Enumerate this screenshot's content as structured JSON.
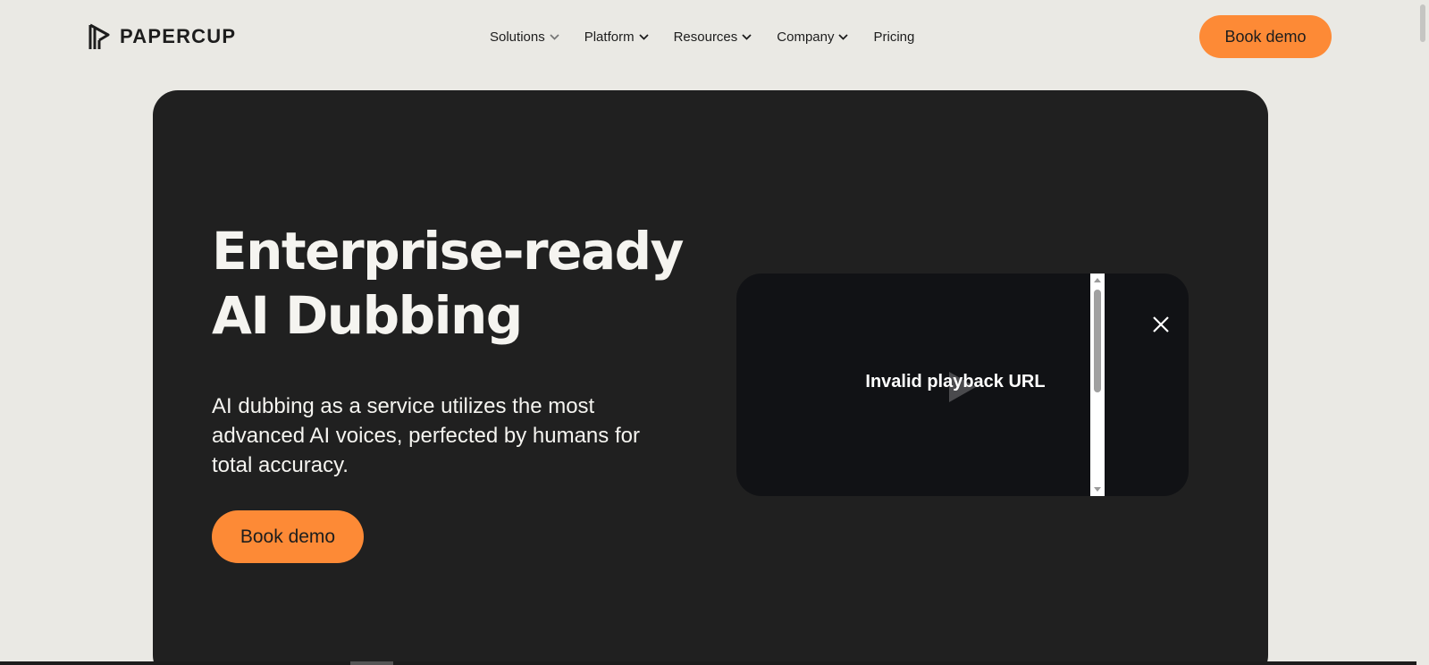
{
  "header": {
    "logo_text": "PAPERCUP",
    "nav": [
      {
        "label": "Solutions",
        "has_dropdown": true
      },
      {
        "label": "Platform",
        "has_dropdown": true
      },
      {
        "label": "Resources",
        "has_dropdown": true
      },
      {
        "label": "Company",
        "has_dropdown": true
      },
      {
        "label": "Pricing",
        "has_dropdown": false
      }
    ],
    "cta_label": "Book demo"
  },
  "hero": {
    "title_line1": "Enterprise-ready",
    "title_line2": "AI Dubbing",
    "description": "AI dubbing as a service utilizes the most advanced AI voices, perfected by humans for total accuracy.",
    "cta_label": "Book demo"
  },
  "video": {
    "error_text": "Invalid playback URL",
    "icons": [
      "play-icon",
      "close-icon"
    ]
  },
  "colors": {
    "background": "#eae9e4",
    "hero_bg": "#202020",
    "accent": "#fd8a36",
    "video_bg": "#111215"
  }
}
